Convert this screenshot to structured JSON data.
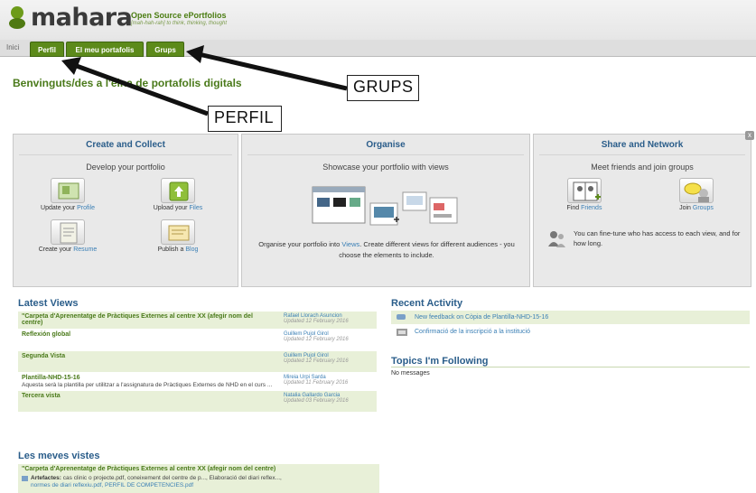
{
  "header": {
    "logo_text": "mahara",
    "tagline": "Open Source ePortfolios",
    "tagline_sub": "[mah-hah-rah] to think, thinking, thought"
  },
  "nav": {
    "home": "Inici",
    "tabs": [
      {
        "label": "Perfil"
      },
      {
        "label": "El meu portafolis"
      },
      {
        "label": "Grups"
      }
    ]
  },
  "welcome": "Benvinguts/des a l'eina de portafolis digitals",
  "annotations": {
    "grups": "GRUPS",
    "perfil": "PERFIL"
  },
  "panels": {
    "create": {
      "title": "Create and Collect",
      "subtitle": "Develop your portfolio",
      "items": [
        {
          "pre": "Update your ",
          "link": "Profile"
        },
        {
          "pre": "Upload your ",
          "link": "Files"
        },
        {
          "pre": "Create your ",
          "link": "Resume"
        },
        {
          "pre": "Publish a ",
          "link": "Blog"
        }
      ]
    },
    "organise": {
      "title": "Organise",
      "subtitle": "Showcase your portfolio with views",
      "text_pre": "Organise your portfolio into ",
      "text_link": "Views",
      "text_post": ". Create different views for different audiences - you choose the elements to include."
    },
    "share": {
      "title": "Share and Network",
      "subtitle": "Meet friends and join groups",
      "items": [
        {
          "pre": "Find ",
          "link": "Friends"
        },
        {
          "pre": "Join ",
          "link": "Groups"
        }
      ],
      "text": "You can fine-tune who has access to each view, and for how long."
    }
  },
  "latest_views": {
    "title": "Latest Views",
    "rows": [
      {
        "name": "\"Carpeta d'Aprenentatge de Pràctiques Externes al centre XX (afegir nom del centre)",
        "desc": "",
        "author": "Rafael Llorach Asuncion",
        "updated": "Updated 12 February 2016"
      },
      {
        "name": "Reflexión global",
        "desc": "",
        "author": "Guillem Pujol Girol",
        "updated": "Updated 12 February 2016"
      },
      {
        "name": "Segunda Vista",
        "desc": "",
        "author": "Guillem Pujol Girol",
        "updated": "Updated 12 February 2016"
      },
      {
        "name": "Plantilla-NHD-15-16",
        "desc": "Aquesta serà la plantilla per utilitzar a l'assignatura de Pràctiques Externes de NHD en el curs ...",
        "author": "Mireia Urpi Sarda",
        "updated": "Updated 11 February 2016"
      },
      {
        "name": "Tercera vista",
        "desc": "",
        "author": "Natalia Gallardo Garcia",
        "updated": "Updated 03 February 2016"
      }
    ]
  },
  "recent_activity": {
    "title": "Recent Activity",
    "rows": [
      {
        "text": "New feedback on Còpia de Plantilla-NHD-15-16"
      },
      {
        "text": "Confirmació de la inscripció a la institució"
      }
    ]
  },
  "topics": {
    "title": "Topics I'm Following",
    "empty": "No messages"
  },
  "my_views": {
    "title": "Les meves vistes",
    "name": "\"Carpeta d'Aprenentatge de Pràctiques Externes al centre XX (afegir nom del centre)",
    "artefacts_label": "Artefactes:",
    "artefacts": "cas clinic o projecte.pdf, coneixement del centre de p..., Elaboració del diari reflex...,",
    "artefacts_more": "normes de diari reflexiu.pdf, PERFIL DE COMPETENCIES.pdf"
  }
}
